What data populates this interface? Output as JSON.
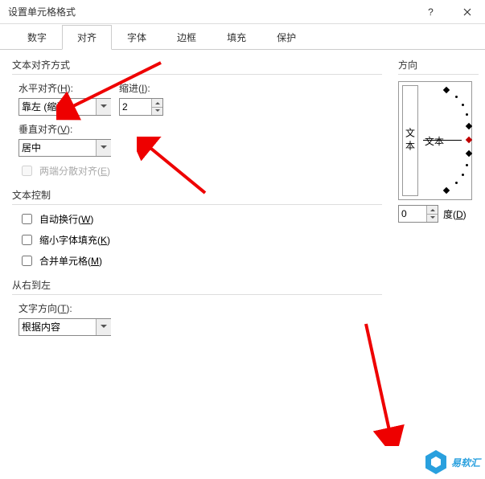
{
  "window": {
    "title": "设置单元格格式"
  },
  "tabs": [
    "数字",
    "对齐",
    "字体",
    "边框",
    "填充",
    "保护"
  ],
  "active_tab_index": 1,
  "align": {
    "group_title": "文本对齐方式",
    "h_label": "水平对齐(H):",
    "h_value": "靠左 (缩进)",
    "indent_label": "缩进(I):",
    "indent_value": "2",
    "v_label": "垂直对齐(V):",
    "v_value": "居中",
    "justify_label": "两端分散对齐(E)"
  },
  "text_ctrl": {
    "group_title": "文本控制",
    "wrap": "自动换行(W)",
    "shrink": "缩小字体填充(K)",
    "merge": "合并单元格(M)"
  },
  "rtl": {
    "group_title": "从右到左",
    "dir_label": "文字方向(T):",
    "dir_value": "根据内容"
  },
  "orientation": {
    "group_title": "方向",
    "vert_text": "文本",
    "dial_text": "文本",
    "deg_value": "0",
    "deg_label": "度(D)"
  },
  "watermark": "易软汇"
}
